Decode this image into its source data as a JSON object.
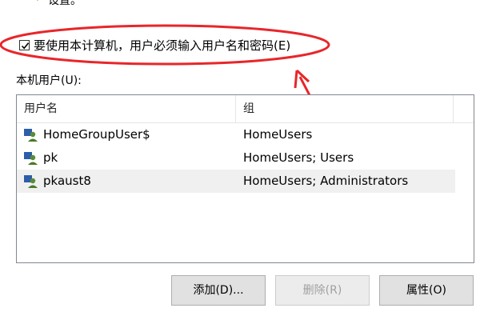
{
  "header": {
    "partial_text": "设置。"
  },
  "checkbox": {
    "label": "要使用本计算机，用户必须输入用户名和密码(E)",
    "checked": true
  },
  "users_section": {
    "label": "本机用户(U):"
  },
  "table": {
    "columns": [
      "用户名",
      "组"
    ],
    "rows": [
      {
        "name": "HomeGroupUser$",
        "group": "HomeUsers",
        "selected": false
      },
      {
        "name": "pk",
        "group": "HomeUsers; Users",
        "selected": false
      },
      {
        "name": "pkaust8",
        "group": "HomeUsers; Administrators",
        "selected": true
      }
    ]
  },
  "buttons": {
    "add": "添加(D)...",
    "remove": "删除(R)",
    "properties": "属性(O)"
  },
  "colors": {
    "annotation": "#e8262a",
    "selection": "#f0f0f0"
  },
  "icons": {
    "user": "user-group-icon",
    "top": "keys-icon"
  }
}
